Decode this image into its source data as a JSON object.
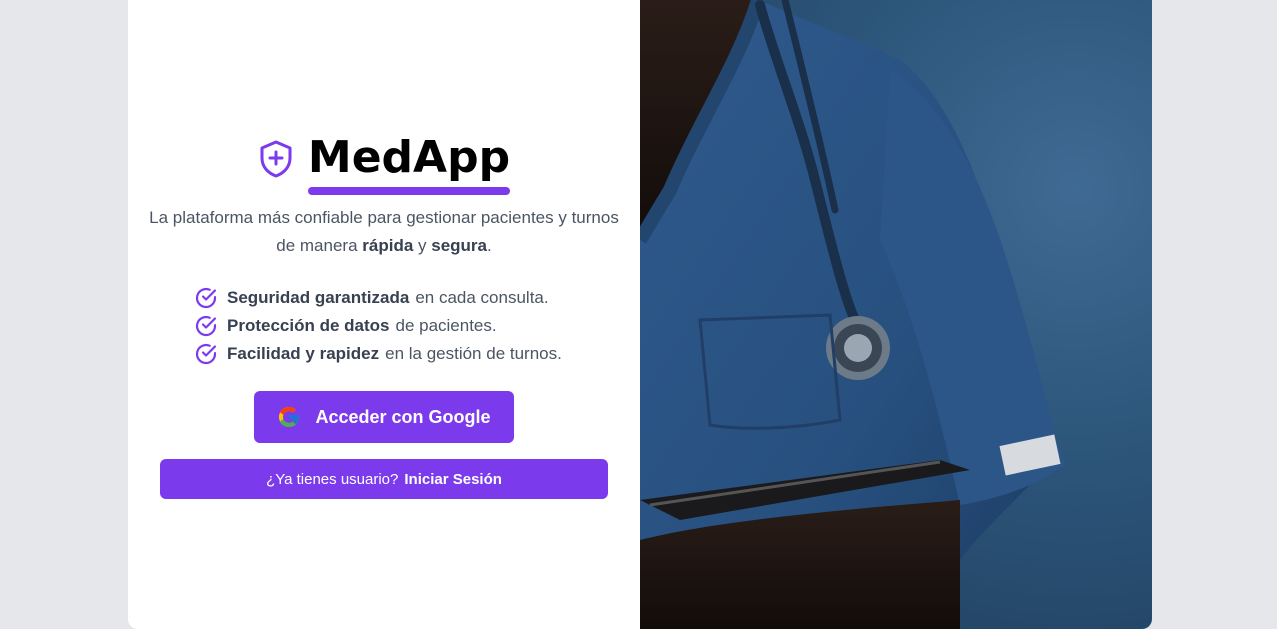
{
  "brand": {
    "name": "MedApp",
    "icon": "shield-plus-icon",
    "accent_color": "#7c3aed"
  },
  "tagline": {
    "part1": "La plataforma más confiable para gestionar pacientes y turnos de manera ",
    "bold1": "rápida",
    "part2": " y ",
    "bold2": "segura",
    "part3": "."
  },
  "features": [
    {
      "icon": "check-circle-icon",
      "bold": "Seguridad garantizada",
      "rest": "en cada consulta."
    },
    {
      "icon": "check-circle-icon",
      "bold": "Protección de datos",
      "rest": "de pacientes."
    },
    {
      "icon": "check-circle-icon",
      "bold": "Facilidad y rapidez",
      "rest": "en la gestión de turnos."
    }
  ],
  "google_button": {
    "label": "Acceder con Google",
    "icon": "google-icon"
  },
  "login_button": {
    "prompt": "¿Ya tienes usuario?",
    "action": "Iniciar Sesión"
  },
  "hero_image": {
    "subject": "nurse-with-stethoscope-photo"
  }
}
